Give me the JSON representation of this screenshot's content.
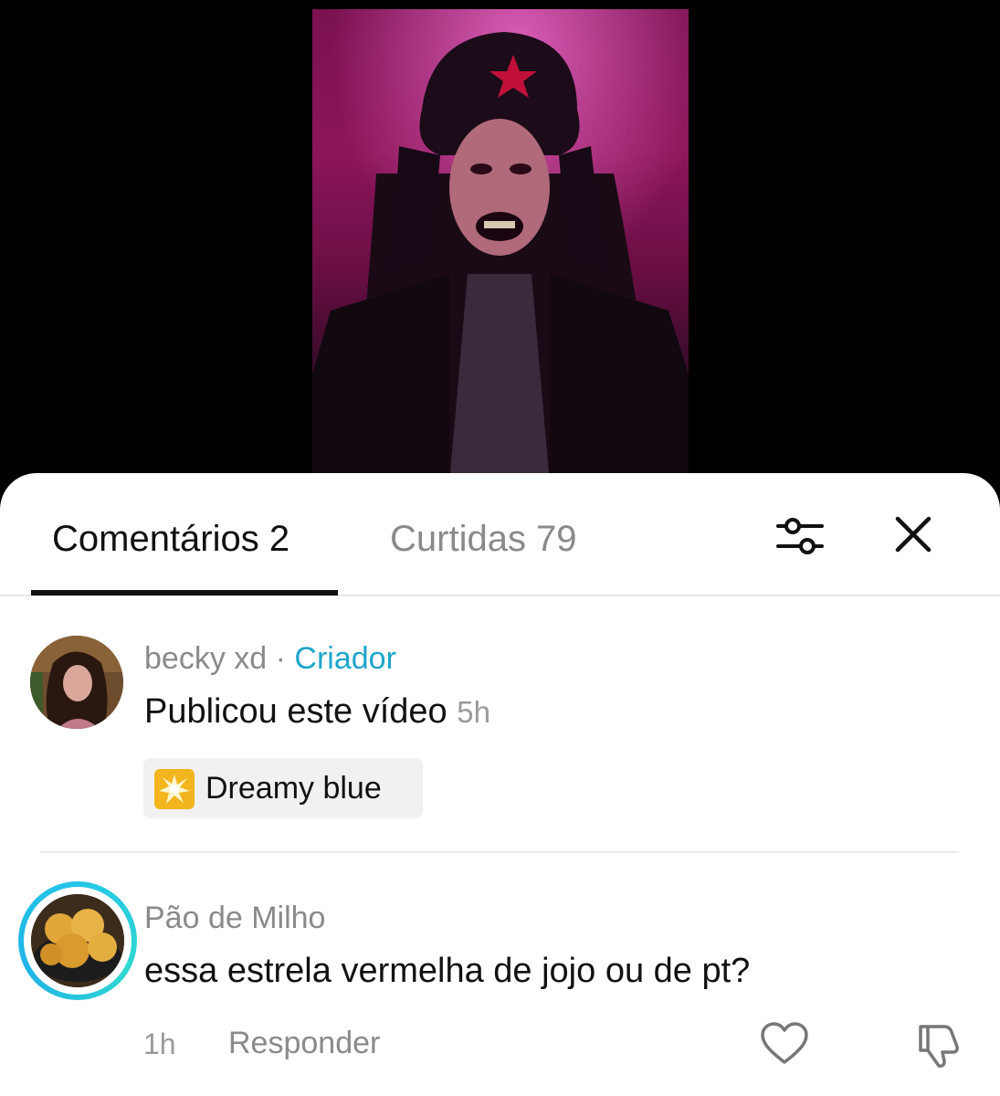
{
  "tabs": {
    "comments_label": "Comentários 2",
    "likes_label": "Curtidas 79"
  },
  "icons": {
    "filter": "sliders-icon",
    "close": "close-icon",
    "like": "heart-icon",
    "dislike": "thumbs-down-icon",
    "effect": "sparkle-icon"
  },
  "colors": {
    "creator_accent": "#1fa6c9",
    "story_ring": "#25c6e8",
    "effect_icon_bg": "#f3b51e"
  },
  "comments": [
    {
      "username": "becky xd",
      "separator": "·",
      "badge": "Criador",
      "text": "Publicou este vídeo",
      "time": "5h",
      "effect": "Dreamy blue"
    },
    {
      "username": "Pão de Milho",
      "text": "essa estrela vermelha de jojo ou de pt?",
      "time": "1h",
      "reply_label": "Responder"
    }
  ]
}
